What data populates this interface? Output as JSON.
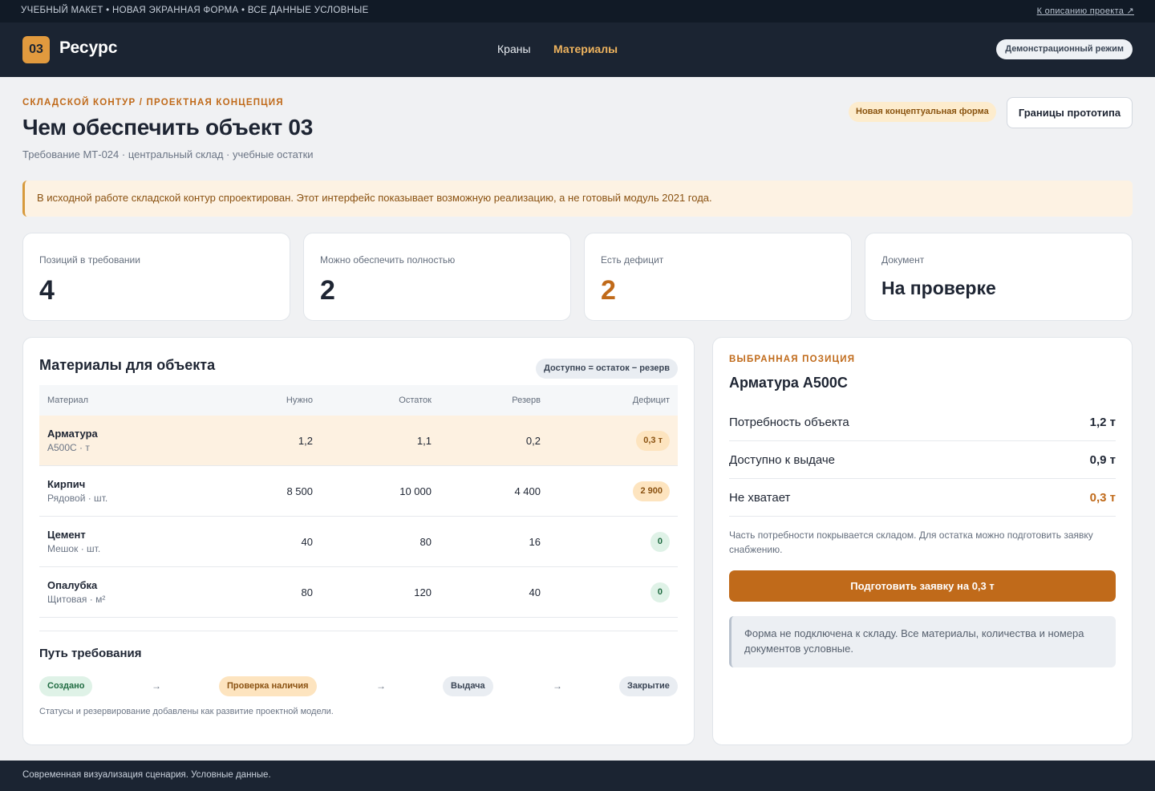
{
  "topbar": {
    "notice": "УЧЕБНЫЙ МАКЕТ • НОВАЯ ЭКРАННАЯ ФОРМА • ВСЕ ДАННЫЕ УСЛОВНЫЕ",
    "link": "К описанию проекта ↗"
  },
  "header": {
    "logo_number": "03",
    "logo_text": "Ресурс",
    "nav": [
      "Краны",
      "Материалы"
    ],
    "active_nav": "Материалы",
    "demo_label": "Демонстрационный режим"
  },
  "page": {
    "eyebrow": "СКЛАДСКОЙ КОНТУР / ПРОЕКТНАЯ КОНЦЕПЦИЯ",
    "title": "Чем обеспечить объект 03",
    "subtitle": "Требование МТ-024 · центральный склад · учебные остатки",
    "concept_badge": "Новая концептуальная форма",
    "limits_button": "Границы прототипа"
  },
  "notice": "В исходной работе складской контур спроектирован. Этот интерфейс показывает возможную реализацию, а не готовый модуль 2021 года.",
  "kpis": [
    {
      "label": "Позиций в требовании",
      "value": "4"
    },
    {
      "label": "Можно обеспечить полностью",
      "value": "2"
    },
    {
      "label": "Есть дефицит",
      "value": "2"
    },
    {
      "label": "Документ",
      "value": "На проверке"
    }
  ],
  "materials": {
    "title": "Материалы для объекта",
    "formula": "Доступно = остаток − резерв",
    "columns": [
      "Материал",
      "Нужно",
      "Остаток",
      "Резерв",
      "Дефицит"
    ],
    "rows": [
      {
        "name": "Арматура",
        "sub": "А500С · т",
        "need": "1,2",
        "stock": "1,1",
        "reserve": "0,2",
        "deficit": "0,3 т",
        "status": "warn",
        "selected": true
      },
      {
        "name": "Кирпич",
        "sub": "Рядовой · шт.",
        "need": "8 500",
        "stock": "10 000",
        "reserve": "4 400",
        "deficit": "2 900",
        "status": "warn",
        "selected": false
      },
      {
        "name": "Цемент",
        "sub": "Мешок · шт.",
        "need": "40",
        "stock": "80",
        "reserve": "16",
        "deficit": "0",
        "status": "ok",
        "selected": false
      },
      {
        "name": "Опалубка",
        "sub": "Щитовая · м²",
        "need": "80",
        "stock": "120",
        "reserve": "40",
        "deficit": "0",
        "status": "ok",
        "selected": false
      }
    ],
    "path_title": "Путь требования",
    "steps": [
      "Создано",
      "Проверка наличия",
      "Выдача",
      "Закрытие"
    ],
    "arrow": "→",
    "path_note": "Статусы и резервирование добавлены как развитие проектной модели."
  },
  "selected": {
    "eyebrow": "ВЫБРАННАЯ ПОЗИЦИЯ",
    "title": "Арматура А500С",
    "metrics": [
      {
        "label": "Потребность объекта",
        "value": "1,2 т"
      },
      {
        "label": "Доступно к выдаче",
        "value": "0,9 т"
      },
      {
        "label": "Не хватает",
        "value": "0,3 т"
      }
    ],
    "note": "Часть потребности покрывается складом. Для остатка можно подготовить заявку снабжению.",
    "button": "Подготовить заявку на 0,3 т",
    "info": "Форма не подключена к складу. Все материалы, количества и номера документов условные."
  },
  "footer": "Современная визуализация сценария. Условные данные.",
  "colors": {
    "accent": "#c06a1a",
    "header_bg": "#1b2432",
    "ok": "#1f6b41",
    "warn_bg": "#fde4bf"
  }
}
